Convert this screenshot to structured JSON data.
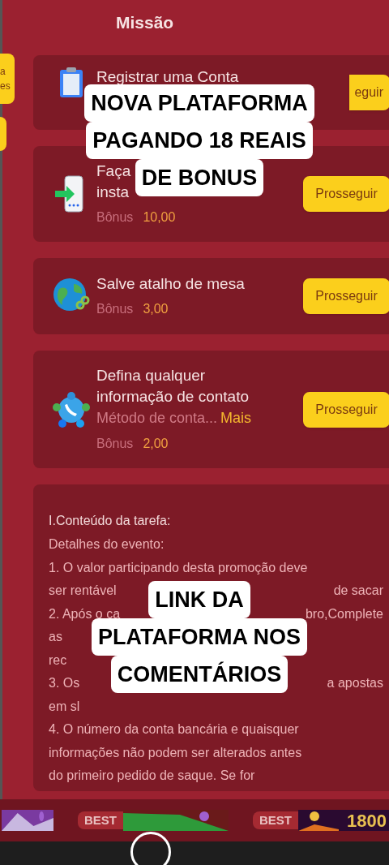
{
  "header": {
    "title": "Missão"
  },
  "side_tabs": [
    {
      "kind": "labeled",
      "label_lines": [
        "a",
        "es"
      ]
    },
    {
      "kind": "plain"
    }
  ],
  "tasks": [
    {
      "kind": "register",
      "title_lines": [
        "Registrar uma Conta"
      ],
      "button": "eguir"
    },
    {
      "kind": "install",
      "title_lines": [
        "Faça",
        "insta"
      ],
      "bonus_label": "Bônus",
      "bonus": "10,00",
      "button": "Prosseguir"
    },
    {
      "kind": "shortcut",
      "title_lines": [
        "Salve atalho de mesa"
      ],
      "bonus_label": "Bônus",
      "bonus": "3,00",
      "button": "Prosseguir"
    },
    {
      "kind": "contact",
      "title_lines": [
        "Defina qualquer",
        "informação de contato"
      ],
      "note": "Método de conta...",
      "more": "Mais",
      "bonus_label": "Bônus",
      "bonus": "2,00",
      "button": "Prosseguir"
    }
  ],
  "details": {
    "heading": "I.Conteúdo da tarefa:",
    "lines": [
      {
        "left": "Detalhes do evento:"
      },
      {
        "left": "1. O valor participando desta promoção deve"
      },
      {
        "left": "ser rentável",
        "right": "de sacar"
      },
      {
        "left": "2. Após o ca",
        "right": "bro,Complete"
      },
      {
        "left": "as"
      },
      {
        "left": "rec"
      },
      {
        "left": "3. Os",
        "right": "a apostas"
      },
      {
        "left": "em sl"
      },
      {
        "left": "4. O número da conta bancária e quaisquer"
      },
      {
        "left": "informações não podem ser alterados antes"
      },
      {
        "left": "do primeiro pedido de saque. Se for"
      }
    ]
  },
  "banner": {
    "games": [
      {
        "kind": "picture"
      },
      {
        "kind": "picture",
        "badge": "BEST"
      },
      {
        "kind": "picture",
        "badge": "BEST",
        "prize": "1800"
      }
    ]
  },
  "captions": [
    {
      "lines": [
        "NOVA PLATAFORMA",
        "PAGANDO 18 REAIS",
        "DE BONUS"
      ]
    },
    {
      "lines": [
        "LINK DA",
        "PLATAFORMA NOS",
        "COMENTÁRIOS"
      ]
    }
  ]
}
